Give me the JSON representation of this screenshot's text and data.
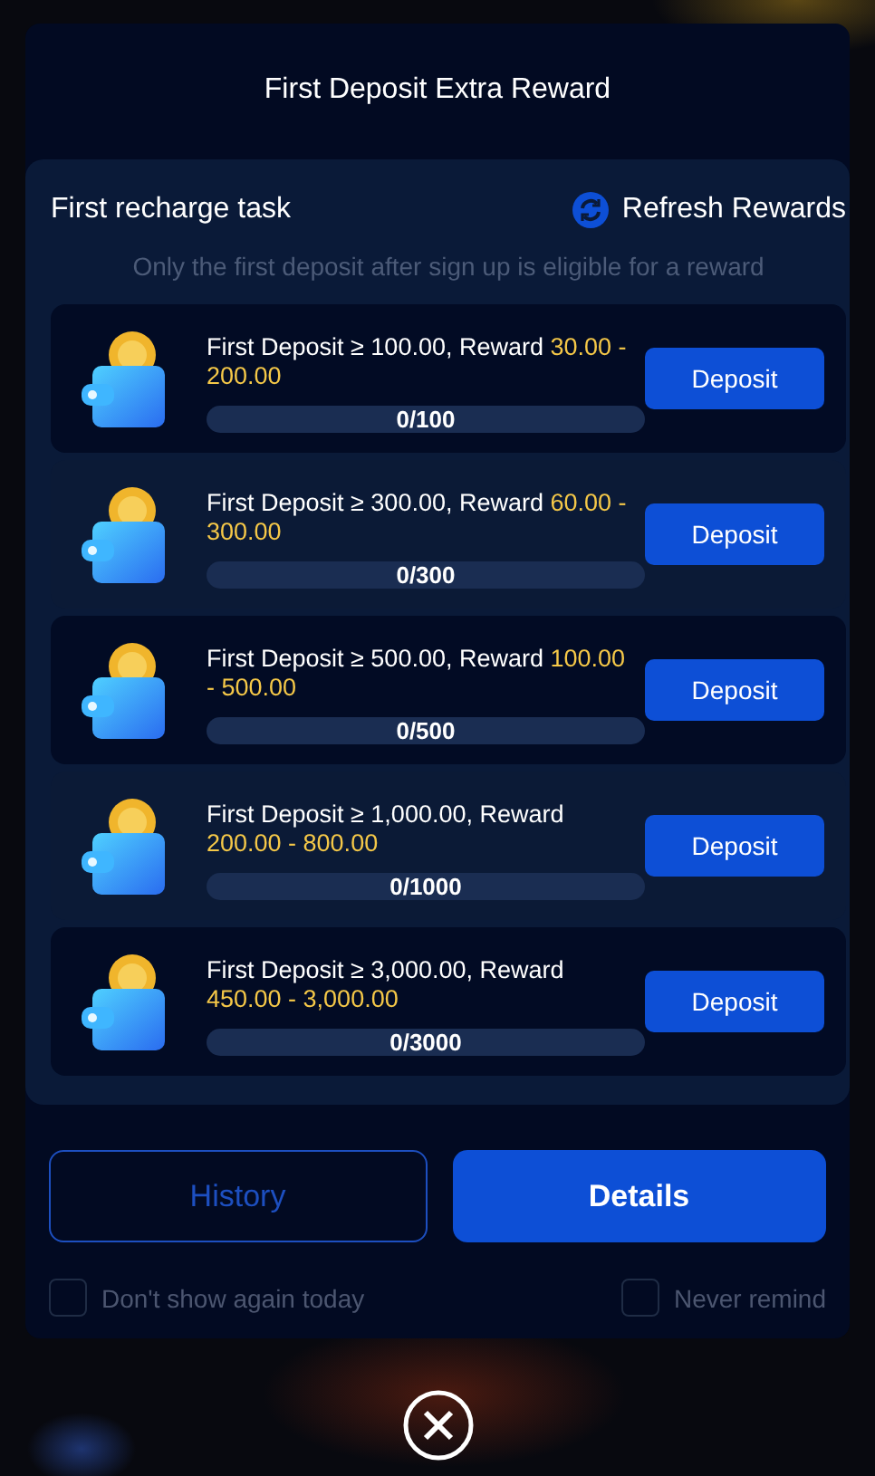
{
  "dialog": {
    "title": "First Deposit Extra Reward"
  },
  "panel": {
    "heading": "First recharge task",
    "refresh": "Refresh Rewards",
    "note": "Only the first deposit after sign up is eligible for a reward"
  },
  "tasks": [
    {
      "condition": "First Deposit ≥ 100.00, Reward ",
      "reward": "30.00 - 200.00",
      "progress": "0/100",
      "button": "Deposit"
    },
    {
      "condition": "First Deposit ≥ 300.00, Reward ",
      "reward": "60.00 - 300.00",
      "progress": "0/300",
      "button": "Deposit"
    },
    {
      "condition": "First Deposit ≥ 500.00, Reward ",
      "reward": "100.00 - 500.00",
      "progress": "0/500",
      "button": "Deposit"
    },
    {
      "condition": "First Deposit ≥ 1,000.00, Reward ",
      "reward": "200.00 - 800.00",
      "progress": "0/1000",
      "button": "Deposit"
    },
    {
      "condition": "First Deposit ≥ 3,000.00, Reward ",
      "reward": "450.00 - 3,000.00",
      "progress": "0/3000",
      "button": "Deposit"
    }
  ],
  "buttons": [
    {
      "label": "History",
      "kind": "outline"
    },
    {
      "label": "Details",
      "kind": "primary"
    }
  ],
  "options": [
    {
      "label": "Don't show again today",
      "checked": false
    },
    {
      "label": "Never remind",
      "checked": false
    }
  ]
}
